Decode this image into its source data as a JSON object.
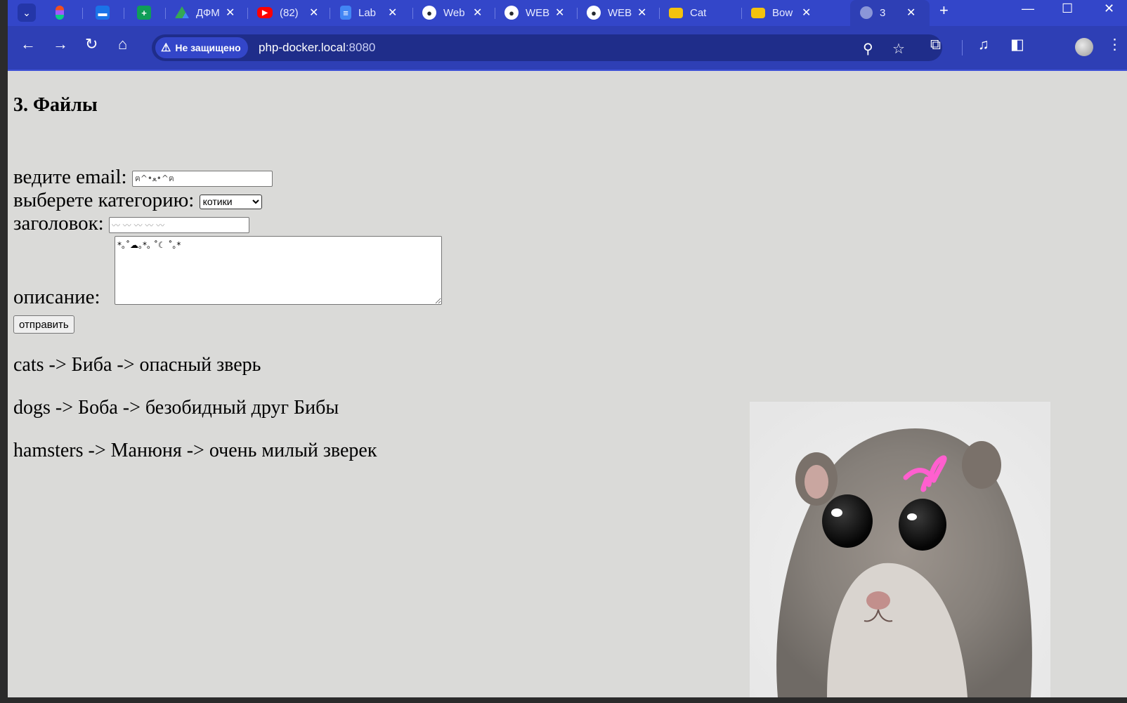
{
  "browser": {
    "tabs": [
      {
        "label": "",
        "icon": "figma-icon"
      },
      {
        "label": "",
        "icon": "chat-icon"
      },
      {
        "label": "",
        "icon": "sheets-icon"
      },
      {
        "label": "ДФМ",
        "icon": "drive-icon"
      },
      {
        "label": "(82)",
        "icon": "youtube-icon"
      },
      {
        "label": "Lab",
        "icon": "docs-icon"
      },
      {
        "label": "Web",
        "icon": "github-icon"
      },
      {
        "label": "WEB",
        "icon": "github-icon"
      },
      {
        "label": "WEB",
        "icon": "github-icon"
      },
      {
        "label": "Cat",
        "icon": "folder-icon"
      },
      {
        "label": "Bow",
        "icon": "folder-icon"
      },
      {
        "label": "3",
        "icon": "globe-icon",
        "active": true
      }
    ],
    "security_label": "Не защищено",
    "url_host": "php-docker.local",
    "url_port": ":8080",
    "colors": {
      "tabbar": "#3346c9",
      "toolbar": "#2e3fb5",
      "page_bg": "#dadad8"
    }
  },
  "page": {
    "title": "3. Файлы",
    "form": {
      "email_label": "ведите email:",
      "email_value": "ฅ^•ﻌ•^ฅ",
      "category_label": "выберете категорию:",
      "category_selected": "котики",
      "heading_label": "заголовок:",
      "heading_value": "〰 〰 〰 〰 〰",
      "description_label": "описание:",
      "description_value": "*｡˚☁｡*｡ ˚☾ ˚｡*",
      "submit_label": "отправить"
    },
    "entries": [
      "cats -> Биба -> опасный зверь",
      "dogs -> Боба -> безобидный друг Бибы",
      "hamsters -> Манюня -> очень милый зверек"
    ]
  }
}
